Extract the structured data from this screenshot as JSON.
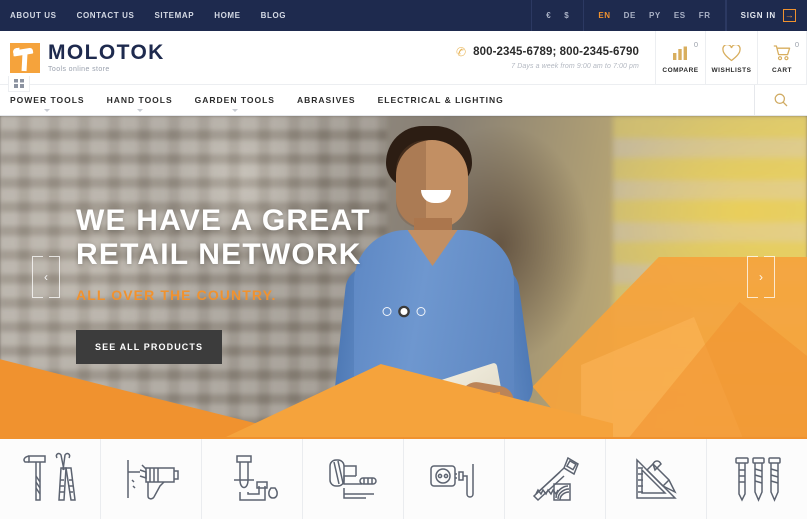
{
  "topbar": {
    "links": [
      {
        "label": "ABOUT US"
      },
      {
        "label": "CONTACT US"
      },
      {
        "label": "SITEMAP"
      },
      {
        "label": "HOME"
      },
      {
        "label": "BLOG"
      }
    ],
    "currencies": [
      {
        "label": "€",
        "active": false
      },
      {
        "label": "$",
        "active": false
      }
    ],
    "languages": [
      {
        "label": "EN",
        "active": true
      },
      {
        "label": "DE",
        "active": false
      },
      {
        "label": "PY",
        "active": false
      },
      {
        "label": "ES",
        "active": false
      },
      {
        "label": "FR",
        "active": false
      }
    ],
    "signin_label": "SIGN IN",
    "signin_icon": "login-arrow-icon",
    "accent_color": "#f0922f",
    "background_color": "#1e2a4e"
  },
  "header": {
    "logo": {
      "brand": "MOLOTOK",
      "tagline": "Tools online store",
      "icon": "hammer-icon",
      "mark_color": "#f5a33c",
      "brand_color": "#1e2a4e"
    },
    "grid_badge_icon": "grid-menu-icon",
    "phone": {
      "icon": "phone-icon",
      "numbers": "800-2345-6789; 800-2345-6790",
      "hours": "7 Days a week from 9:00 am to 7:00 pm"
    },
    "tools": [
      {
        "label": "COMPARE",
        "count": "0",
        "icon": "compare-bars-icon"
      },
      {
        "label": "WISHLISTS",
        "count": "",
        "icon": "heart-icon"
      },
      {
        "label": "CART",
        "count": "0",
        "icon": "cart-icon"
      }
    ],
    "tool_icon_color": "#d8ae5e"
  },
  "mainnav": {
    "items": [
      {
        "label": "POWER TOOLS",
        "has_dropdown": true
      },
      {
        "label": "HAND TOOLS",
        "has_dropdown": true
      },
      {
        "label": "GARDEN TOOLS",
        "has_dropdown": true
      },
      {
        "label": "ABRASIVES",
        "has_dropdown": false
      },
      {
        "label": "ELECTRICAL & LIGHTING",
        "has_dropdown": false
      }
    ],
    "search_icon": "search-icon"
  },
  "hero": {
    "heading_line1": "WE HAVE A GREAT",
    "heading_line2": "RETAIL NETWORK",
    "subheading": "ALL OVER THE COUNTRY.",
    "button_label": "SEE ALL PRODUCTS",
    "prev_arrow_icon": "chevron-left-icon",
    "next_arrow_icon": "chevron-right-icon",
    "prev_glyph": "‹",
    "next_glyph": "›",
    "slides": [
      {
        "active": false
      },
      {
        "active": true
      },
      {
        "active": false
      }
    ],
    "accent_color": "#f0922f",
    "heading_color": "#ffffff",
    "button_color": "#3c3c3c"
  },
  "categories": [
    {
      "name": "hammer-pliers-icon",
      "label": "Hand Tools"
    },
    {
      "name": "drill-icon",
      "label": "Power Tools"
    },
    {
      "name": "plumbing-pipe-icon",
      "label": "Plumbing"
    },
    {
      "name": "paint-roller-icon",
      "label": "Painting"
    },
    {
      "name": "electrical-outlet-icon",
      "label": "Electrical"
    },
    {
      "name": "saw-icon",
      "label": "Cutting"
    },
    {
      "name": "ruler-pencil-icon",
      "label": "Measuring"
    },
    {
      "name": "screws-nails-icon",
      "label": "Fasteners"
    }
  ]
}
